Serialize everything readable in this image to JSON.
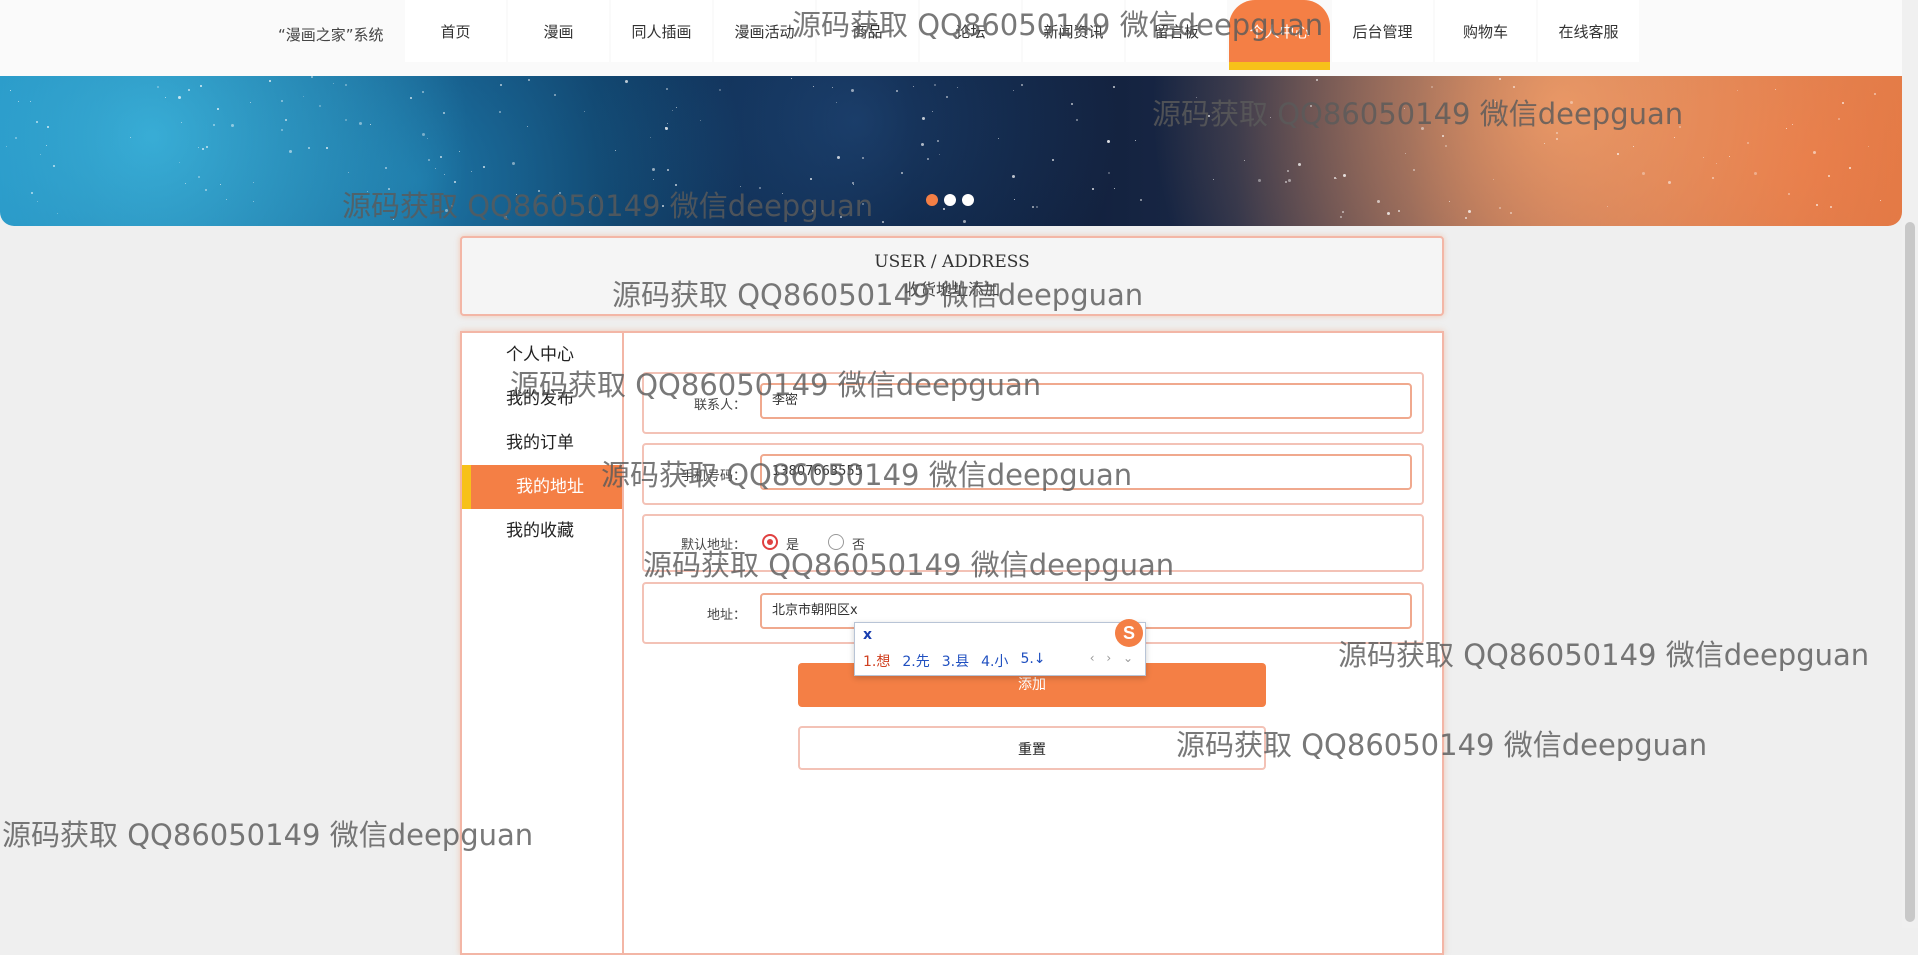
{
  "brand": "“漫画之家”系统",
  "nav": {
    "items": [
      "首页",
      "漫画",
      "同人插画",
      "漫画活动",
      "商品",
      "论坛",
      "新闻资讯",
      "留言板",
      "个人中心",
      "后台管理",
      "购物车",
      "在线客服"
    ],
    "active_index": 8
  },
  "title_box": {
    "en": "USER / ADDRESS",
    "cn": "收货地址添加"
  },
  "sidebar": {
    "items": [
      "个人中心",
      "我的发布",
      "我的订单",
      "我的地址",
      "我的收藏"
    ],
    "active_index": 3
  },
  "form": {
    "contact_label": "联系人：",
    "contact_value": "李密",
    "phone_label": "手机号码：",
    "phone_value": "13807663555",
    "default_label": "默认地址：",
    "default_yes": "是",
    "default_no": "否",
    "default_selected": "是",
    "address_label": "地址：",
    "address_value": "北京市朝阳区x",
    "add_button": "添加",
    "reset_button": "重置"
  },
  "ime": {
    "composition": "x",
    "candidates": [
      "1.想",
      "2.先",
      "3.县",
      "4.小",
      "5.↓"
    ],
    "nav": "‹ › ⌄",
    "logo": "S"
  },
  "watermark_text": "源码获取 QQ86050149 微信deepguan",
  "colors": {
    "accent": "#f47f45",
    "accent_yellow": "#f7c11a",
    "border": "#f3b6a6"
  }
}
